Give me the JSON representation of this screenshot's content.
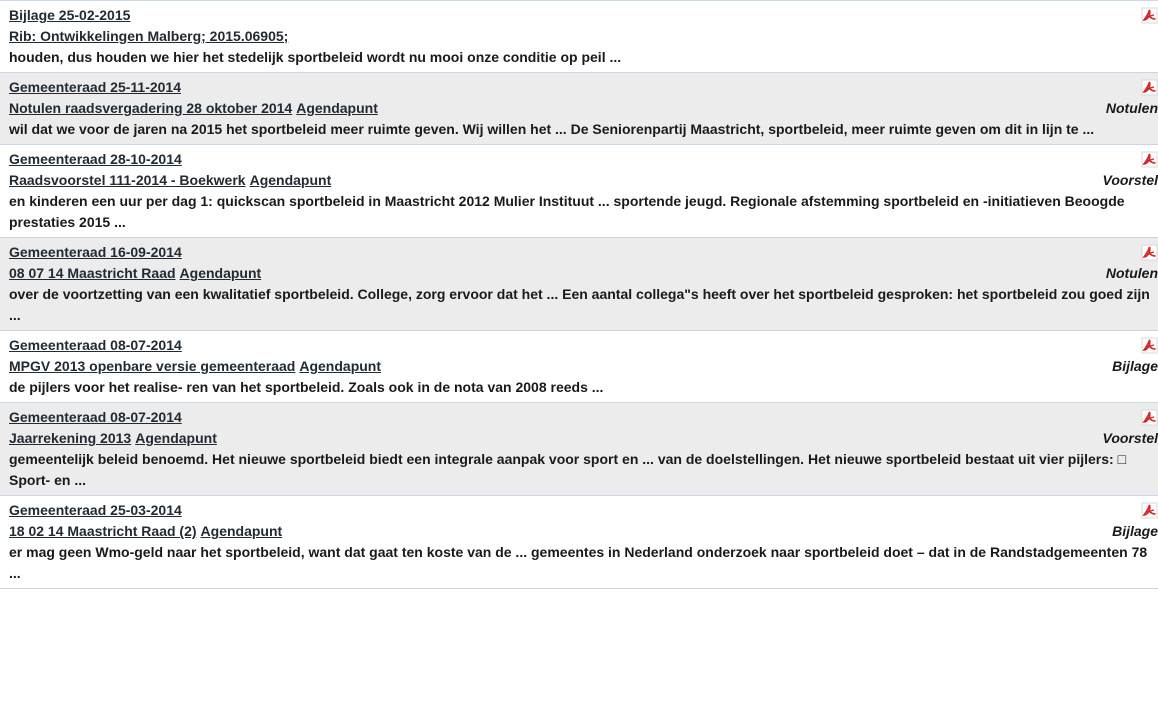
{
  "results": [
    {
      "meeting": "Bijlage 25-02-2015",
      "document": "Rib: Ontwikkelingen Malberg; 2015.06905;",
      "agendapunt": "",
      "doctype": "",
      "snippet": "houden, dus houden we hier het stedelijk sportbeleid wordt nu mooi onze conditie op peil ...",
      "icon": "pdf-icon"
    },
    {
      "meeting": "Gemeenteraad 25-11-2014",
      "document": "Notulen raadsvergadering 28 oktober 2014",
      "agendapunt": "Agendapunt",
      "doctype": "Notulen",
      "snippet": "wil dat we voor de jaren na 2015 het sportbeleid meer ruimte geven. Wij willen het ... De Seniorenpartij Maastricht, sportbeleid, meer ruimte geven om dit in lijn te ...",
      "icon": "pdf-icon"
    },
    {
      "meeting": "Gemeenteraad 28-10-2014",
      "document": "Raadsvoorstel 111-2014 - Boekwerk",
      "agendapunt": "Agendapunt",
      "doctype": "Voorstel",
      "snippet": "en kinderen een uur per dag 1: quickscan sportbeleid in Maastricht 2012 Mulier Instituut ... sportende jeugd. Regionale afstemming sportbeleid en -initiatieven Beoogde prestaties 2015 ...",
      "icon": "pdf-icon"
    },
    {
      "meeting": "Gemeenteraad 16-09-2014",
      "document": "08 07 14 Maastricht Raad",
      "agendapunt": "Agendapunt",
      "doctype": "Notulen",
      "snippet": "over de voortzetting van een kwalitatief sportbeleid. College, zorg ervoor dat het ... Een aantal collega\"s heeft over het sportbeleid gesproken: het sportbeleid zou goed zijn ...",
      "icon": "pdf-icon"
    },
    {
      "meeting": "Gemeenteraad 08-07-2014",
      "document": "MPGV 2013 openbare versie gemeenteraad",
      "agendapunt": "Agendapunt",
      "doctype": "Bijlage",
      "snippet": "de pijlers voor het realise- ren van het sportbeleid. Zoals ook in de nota van 2008 reeds ...",
      "icon": "pdf-icon"
    },
    {
      "meeting": "Gemeenteraad 08-07-2014",
      "document": "Jaarrekening 2013",
      "agendapunt": "Agendapunt",
      "doctype": "Voorstel",
      "snippet": "gemeentelijk beleid benoemd. Het nieuwe sportbeleid biedt een integrale aanpak voor sport en ... van de doelstellingen. Het nieuwe sportbeleid bestaat uit vier pijlers: □ Sport- en ...",
      "icon": "pdf-icon"
    },
    {
      "meeting": "Gemeenteraad 25-03-2014",
      "document": "18 02 14 Maastricht Raad (2)",
      "agendapunt": "Agendapunt",
      "doctype": "Bijlage",
      "snippet": "er mag geen Wmo-geld naar het sportbeleid, want dat gaat ten koste van de ... gemeentes in Nederland onderzoek naar sportbeleid doet – dat in de Randstadgemeenten 78 ...",
      "icon": "pdf-icon"
    }
  ],
  "colors": {
    "pdf_icon": "#d42424",
    "row_alt_bg": "#ececec",
    "divider": "#c8d6e5"
  }
}
